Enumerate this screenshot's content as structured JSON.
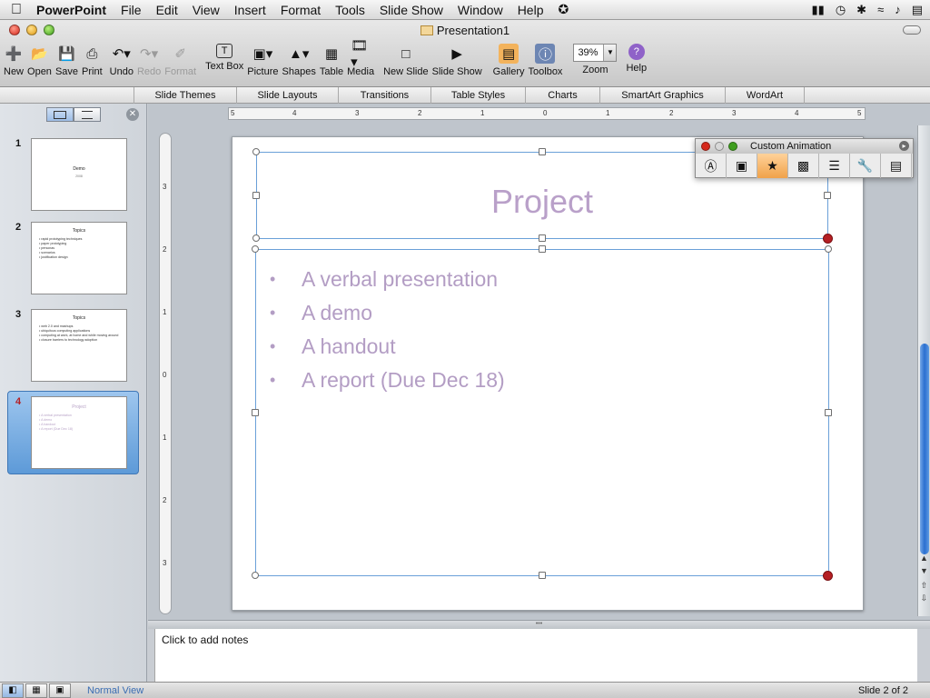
{
  "menubar": {
    "apple": "",
    "app": "PowerPoint",
    "items": [
      "File",
      "Edit",
      "View",
      "Insert",
      "Format",
      "Tools",
      "Slide Show",
      "Window",
      "Help"
    ],
    "script_icon": "script-icon"
  },
  "window": {
    "title": "Presentation1"
  },
  "toolbar": {
    "new": "New",
    "open": "Open",
    "save": "Save",
    "print": "Print",
    "undo": "Undo",
    "redo": "Redo",
    "format": "Format",
    "textbox": "Text Box",
    "picture": "Picture",
    "shapes": "Shapes",
    "table": "Table",
    "media": "Media",
    "newslide": "New Slide",
    "slideshow": "Slide Show",
    "gallery": "Gallery",
    "toolbox": "Toolbox",
    "zoom_value": "39%",
    "zoom": "Zoom",
    "help": "Help"
  },
  "ribbon": {
    "tabs": [
      "Slide Themes",
      "Slide Layouts",
      "Transitions",
      "Table Styles",
      "Charts",
      "SmartArt Graphics",
      "WordArt"
    ]
  },
  "ruler": {
    "h": [
      "5",
      "4",
      "3",
      "2",
      "1",
      "0",
      "1",
      "2",
      "3",
      "4",
      "5"
    ],
    "v": [
      "3",
      "2",
      "1",
      "0",
      "1",
      "2",
      "3"
    ]
  },
  "slides": [
    {
      "num": "1",
      "title": "Demo",
      "subtitle": "2008"
    },
    {
      "num": "2",
      "title": "Topics",
      "bullets": [
        "rapid prototyping techniques",
        "paper prototyping",
        "personas",
        "scenarios",
        "justification design"
      ]
    },
    {
      "num": "3",
      "title": "Topics",
      "bullets": [
        "web 2.0 and mashups",
        "ubiquitous computing applications",
        "computing at work, at home and while moving around",
        "closure barriers to technology adoption"
      ]
    },
    {
      "num": "4",
      "title": "Project",
      "bullets": [
        "A verbal presentation",
        "A demo",
        "A handout",
        "A report (Due Dec 18)"
      ]
    }
  ],
  "current_slide": {
    "title": "Project",
    "bullets": [
      "A verbal presentation",
      "A demo",
      "A handout",
      "A report (Due Dec 18)"
    ]
  },
  "palette": {
    "title": "Custom Animation"
  },
  "notes": {
    "placeholder": "Click to add notes"
  },
  "status": {
    "view": "Normal View",
    "slide": "Slide 2 of 2"
  },
  "colors": {
    "title_text": "#b9a0c9",
    "body_text": "#b39dc4",
    "selection": "#6aa0d8",
    "rotation_handle": "#b51f24"
  }
}
